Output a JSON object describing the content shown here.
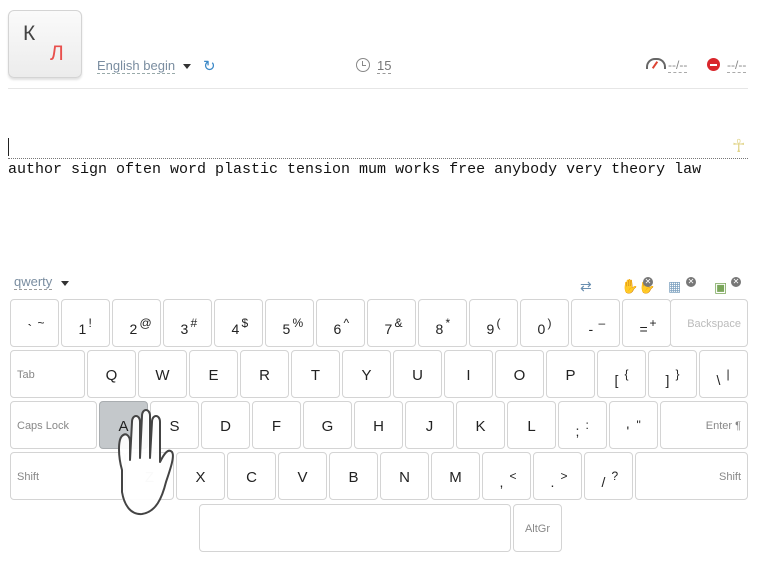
{
  "logo": {
    "k": "К",
    "l": "Л"
  },
  "header": {
    "lesson": "English begin",
    "timer": "15",
    "speed": "--/--",
    "errors": "--/--"
  },
  "editor": {
    "text": "author sign often word plastic tension mum works free anybody very theory law"
  },
  "keyboard": {
    "layout_label": "qwerty",
    "row1": [
      {
        "main": "`",
        "shift": "~"
      },
      {
        "main": "1",
        "shift": "!"
      },
      {
        "main": "2",
        "shift": "@"
      },
      {
        "main": "3",
        "shift": "#"
      },
      {
        "main": "4",
        "shift": "$"
      },
      {
        "main": "5",
        "shift": "%"
      },
      {
        "main": "6",
        "shift": "^"
      },
      {
        "main": "7",
        "shift": "&"
      },
      {
        "main": "8",
        "shift": "*"
      },
      {
        "main": "9",
        "shift": "("
      },
      {
        "main": "0",
        "shift": ")"
      },
      {
        "main": "-",
        "shift": "–"
      },
      {
        "main": "=",
        "shift": "+"
      }
    ],
    "backspace": "Backspace",
    "tab": "Tab",
    "row2": [
      "Q",
      "W",
      "E",
      "R",
      "T",
      "Y",
      "U",
      "I",
      "O",
      "P"
    ],
    "row2_sym": [
      {
        "main": "[",
        "shift": "{"
      },
      {
        "main": "]",
        "shift": "}"
      },
      {
        "main": "\\",
        "shift": "|"
      }
    ],
    "caps": "Caps Lock",
    "row3": [
      "A",
      "S",
      "D",
      "F",
      "G",
      "H",
      "J",
      "K",
      "L"
    ],
    "row3_sym": [
      {
        "main": ";",
        "shift": ":"
      },
      {
        "main": "'",
        "shift": "\""
      }
    ],
    "enter": "Enter ¶",
    "shift_left": "Shift",
    "row4": [
      "Z",
      "X",
      "C",
      "V",
      "B",
      "N",
      "M"
    ],
    "row4_sym": [
      {
        "main": ",",
        "shift": "<"
      },
      {
        "main": ".",
        "shift": ">"
      },
      {
        "main": "/",
        "shift": "?"
      }
    ],
    "shift_right": "Shift",
    "altgr": "AltGr",
    "active_key": "A"
  },
  "colors": {
    "accent": "#3a88c7",
    "error": "#d9262c",
    "active_key": "#c4c8cb"
  }
}
